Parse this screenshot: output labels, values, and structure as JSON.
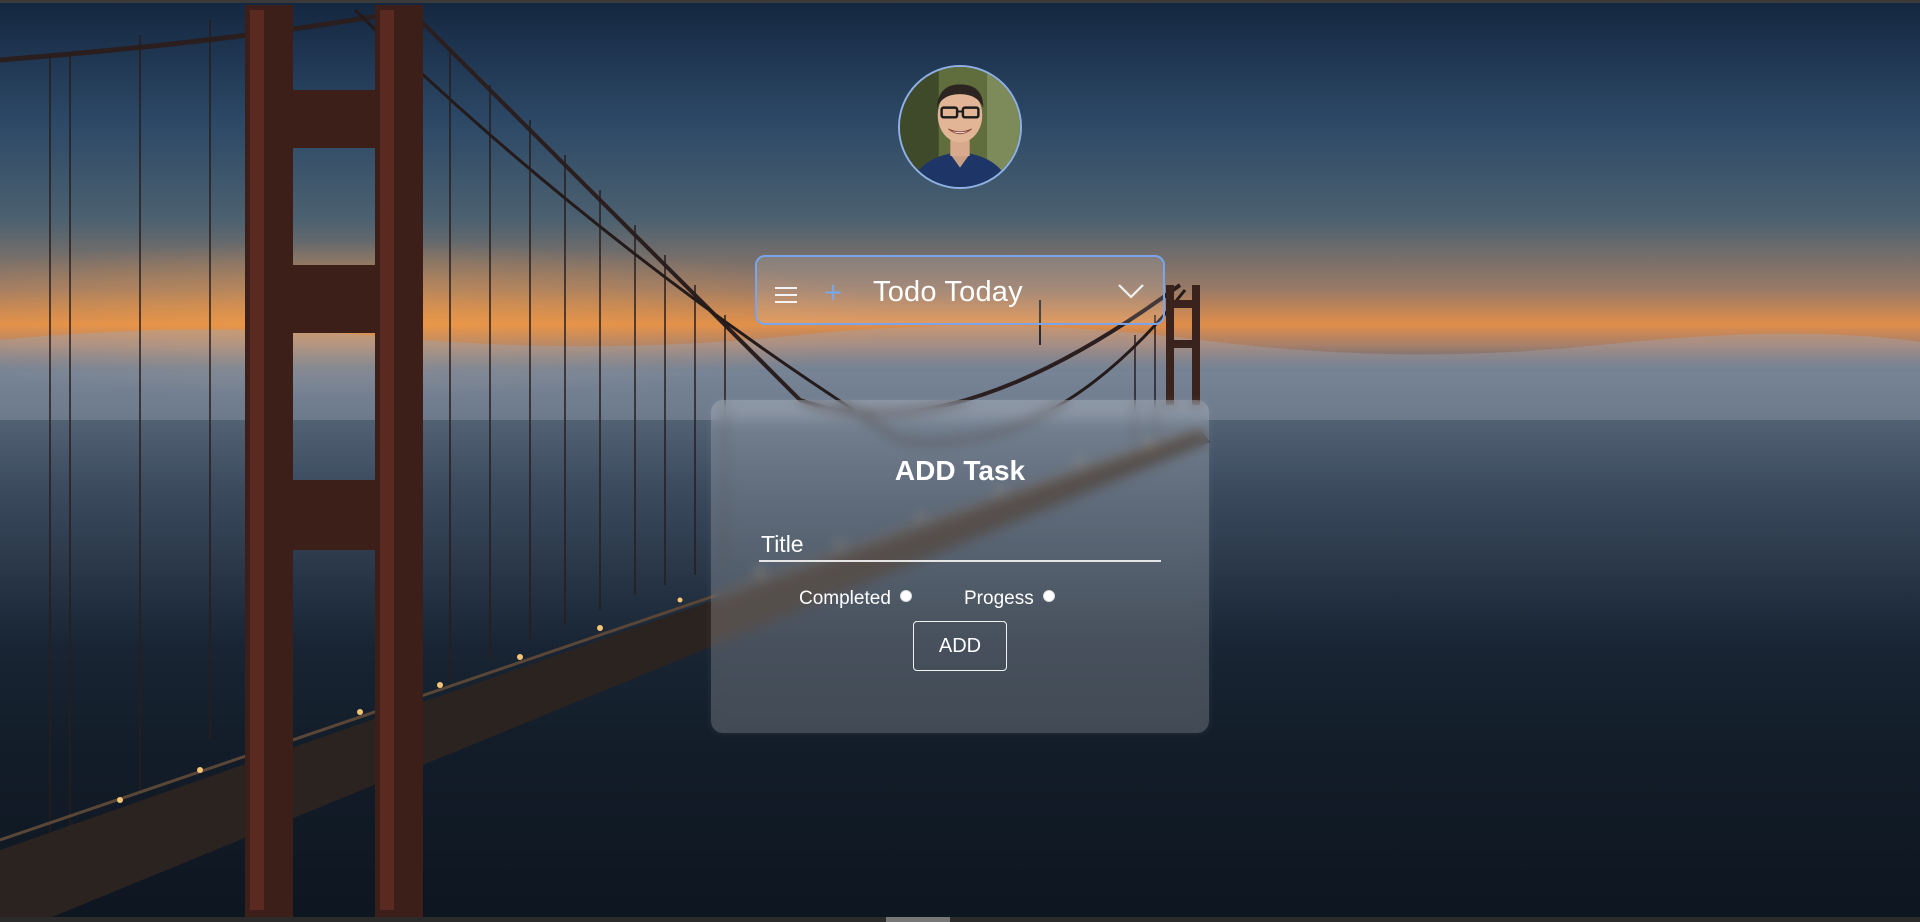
{
  "header": {
    "title": "Todo Today",
    "accent_color": "#7aa4ec",
    "icons": [
      "menu-icon",
      "plus-icon",
      "chevron-down-icon"
    ]
  },
  "avatar": {
    "icon": "user-avatar"
  },
  "card": {
    "title": "ADD Task",
    "title_input": {
      "placeholder": "Title",
      "value": ""
    },
    "options": [
      {
        "label": "Completed"
      },
      {
        "label": "Progess"
      }
    ],
    "add_label": "ADD"
  }
}
